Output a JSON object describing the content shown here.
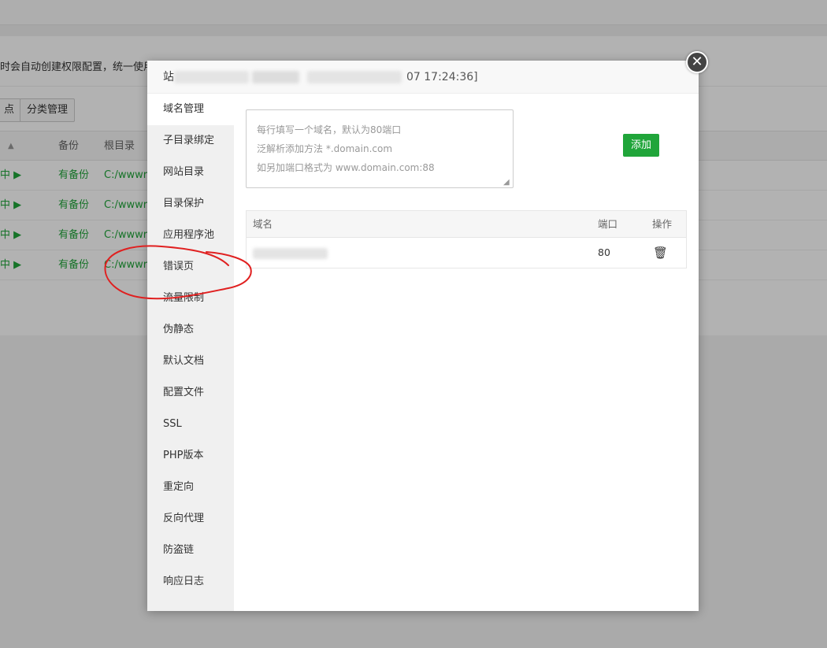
{
  "background": {
    "notice_text": "时会自动创建权限配置，统一使用w",
    "buttons": [
      "点",
      "分类管理"
    ],
    "table_headers": [
      "备份",
      "根目录"
    ],
    "rows": [
      {
        "status": "中 ▶",
        "backup": "有备份",
        "root": "C:/wwwro"
      },
      {
        "status": "中 ▶",
        "backup": "有备份",
        "root": "C:/wwwro"
      },
      {
        "status": "中 ▶",
        "backup": "有备份",
        "root": "C:/wwwro"
      },
      {
        "status": "中 ▶",
        "backup": "有备份",
        "root": "C:/wwwro"
      }
    ]
  },
  "modal": {
    "title_prefix": "站",
    "title_tail": "07 17:24:36]",
    "close_symbol": "✕",
    "sidebar": [
      {
        "label": "域名管理",
        "active": true
      },
      {
        "label": "子目录绑定"
      },
      {
        "label": "网站目录"
      },
      {
        "label": "目录保护"
      },
      {
        "label": "应用程序池"
      },
      {
        "label": "错误页"
      },
      {
        "label": "流量限制"
      },
      {
        "label": "伪静态"
      },
      {
        "label": "默认文档"
      },
      {
        "label": "配置文件"
      },
      {
        "label": "SSL"
      },
      {
        "label": "PHP版本"
      },
      {
        "label": "重定向"
      },
      {
        "label": "反向代理"
      },
      {
        "label": "防盗链"
      },
      {
        "label": "响应日志"
      }
    ],
    "textarea_placeholder_lines": [
      "每行填写一个域名，默认为80端口",
      "泛解析添加方法 *.domain.com",
      "如另加端口格式为 www.domain.com:88"
    ],
    "add_button": "添加",
    "table": {
      "headers": {
        "domain": "域名",
        "port": "端口",
        "action": "操作"
      },
      "rows": [
        {
          "port": "80"
        }
      ]
    }
  },
  "colors": {
    "accent": "#20a53a",
    "annotation": "#e02020"
  }
}
